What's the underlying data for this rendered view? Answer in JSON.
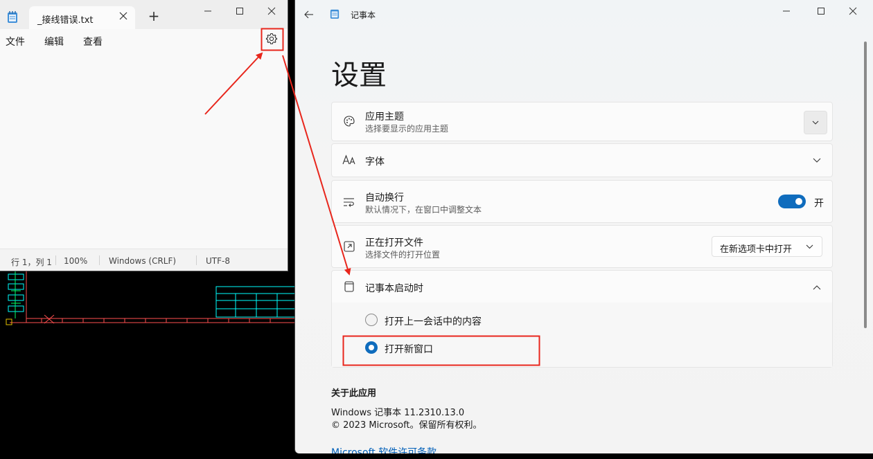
{
  "notepad": {
    "tab_title": "_接线错误.txt",
    "new_tab": "+",
    "menu": [
      "文件",
      "编辑",
      "查看"
    ],
    "status": {
      "position": "行 1，列 1",
      "zoom": "100%",
      "line_ending": "Windows (CRLF)",
      "encoding": "UTF-8"
    }
  },
  "settings": {
    "app_title": "记事本",
    "heading": "设置",
    "theme": {
      "title": "应用主题",
      "subtitle": "选择要显示的应用主题"
    },
    "font": {
      "title": "字体"
    },
    "wrap": {
      "title": "自动换行",
      "subtitle": "默认情况下，在窗口中调整文本",
      "state_label": "开",
      "on": true
    },
    "open_files": {
      "title": "正在打开文件",
      "subtitle": "选择文件的打开位置",
      "selected": "在新选项卡中打开"
    },
    "startup": {
      "title": "记事本启动时",
      "options": [
        "打开上一会话中的内容",
        "打开新窗口"
      ],
      "selected_index": 1
    },
    "about": {
      "heading": "关于此应用",
      "version": "Windows 记事本 11.2310.13.0",
      "copyright": "© 2023 Microsoft。保留所有权利。",
      "license_link": "Microsoft 软件许可条款"
    }
  },
  "colors": {
    "accent": "#0f6cbd",
    "annotation": "#e8261c",
    "cad_line": "#00ffff",
    "cad_red": "#ff4040"
  }
}
